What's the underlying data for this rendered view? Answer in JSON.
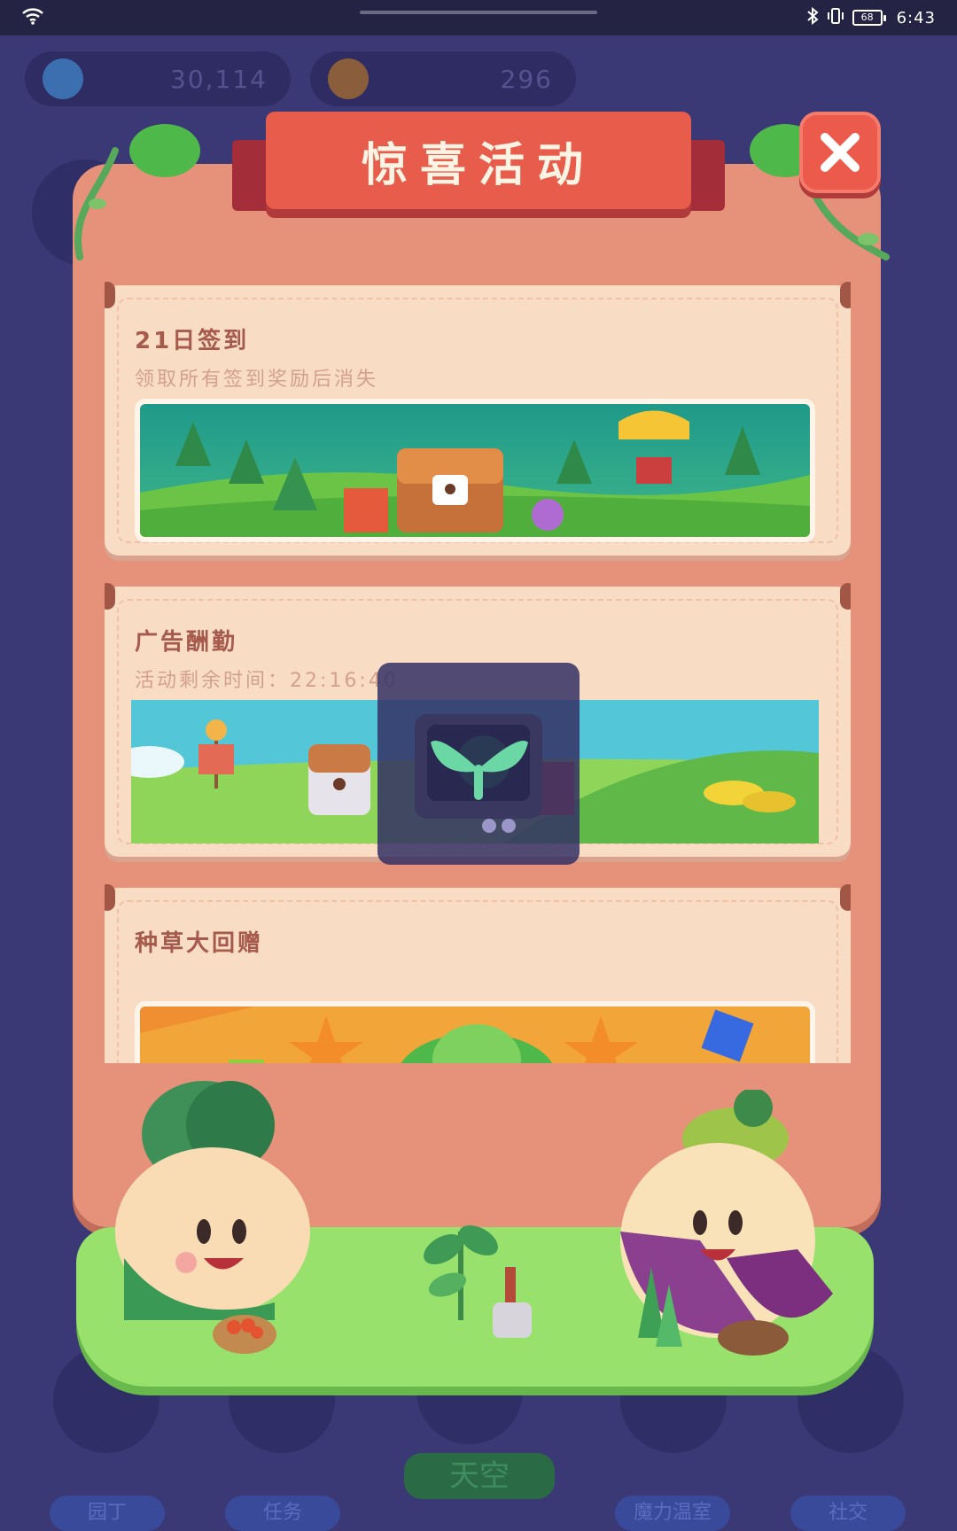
{
  "status_bar": {
    "time": "6:43",
    "battery": "68",
    "icons": [
      "wifi-icon",
      "bluetooth-icon",
      "vibrate-icon",
      "battery-icon"
    ]
  },
  "background": {
    "water_value": "30,114",
    "sun_value": "296",
    "nav": [
      "园丁",
      "任务",
      "天空",
      "魔力温室",
      "社交"
    ]
  },
  "modal": {
    "title": "惊喜活动",
    "close_icon": "close-icon",
    "cards": [
      {
        "title": "21日签到",
        "subtitle": "领取所有签到奖励后消失",
        "image_icon": "treasure-chest-banner"
      },
      {
        "title": "广告酬勤",
        "subtitle": "活动剩余时间：22:16:40",
        "image_icon": "scarecrow-banner"
      },
      {
        "title": "种草大回赠",
        "subtitle": "",
        "image_icon": "grass-stars-banner"
      }
    ]
  },
  "overlay": {
    "icon": "sprout-app-icon"
  },
  "colors": {
    "title_red": "#e85c4b",
    "board": "#e6917a",
    "card": "#f9dcc4",
    "grass": "#98e16c"
  }
}
